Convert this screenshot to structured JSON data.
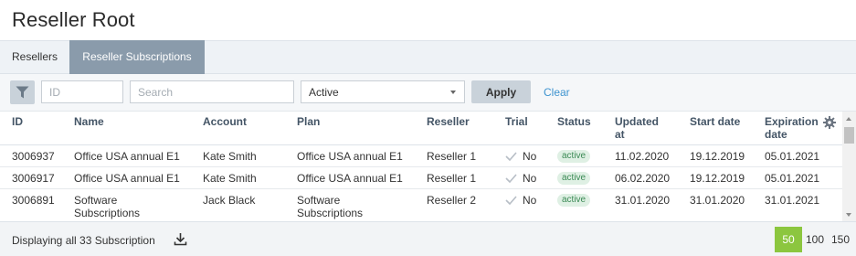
{
  "page": {
    "title": "Reseller Root"
  },
  "tabs": [
    {
      "label": "Resellers",
      "active": false
    },
    {
      "label": "Reseller Subscriptions",
      "active": true
    }
  ],
  "filters": {
    "filter_icon": "filter-icon",
    "id_placeholder": "ID",
    "search_placeholder": "Search",
    "status_value": "Active",
    "apply_label": "Apply",
    "clear_label": "Clear"
  },
  "table": {
    "columns": [
      "ID",
      "Name",
      "Account",
      "Plan",
      "Reseller",
      "Trial",
      "Status",
      "Updated at",
      "Start date",
      "Expiration date"
    ],
    "rows": [
      {
        "id": "3006937",
        "name": "Office USA annual E1",
        "account": "Kate Smith",
        "plan": "Office USA annual E1",
        "reseller": "Reseller 1",
        "trial": "No",
        "status": "active",
        "updated": "11.02.2020",
        "start": "19.12.2019",
        "expiration": "05.01.2021"
      },
      {
        "id": "3006917",
        "name": "Office USA annual E1",
        "account": "Kate Smith",
        "plan": "Office USA annual E1",
        "reseller": "Reseller 1",
        "trial": "No",
        "status": "active",
        "updated": "06.02.2020",
        "start": "19.12.2019",
        "expiration": "05.01.2021"
      },
      {
        "id": "3006891",
        "name": "Software Subscriptions",
        "account": "Jack Black",
        "plan": "Software Subscriptions",
        "reseller": "Reseller 2",
        "trial": "No",
        "status": "active",
        "updated": "31.01.2020",
        "start": "31.01.2020",
        "expiration": "31.01.2021"
      }
    ]
  },
  "footer": {
    "summary": "Displaying all 33 Subscription",
    "page_sizes": [
      "50",
      "100",
      "150"
    ],
    "selected_page_size": "50"
  },
  "colors": {
    "active_tab": "#8a9bab",
    "selected_page_size": "#8cc63f",
    "link": "#3d93cf",
    "badge_bg": "#dff0e4",
    "badge_text": "#3b8a55"
  }
}
